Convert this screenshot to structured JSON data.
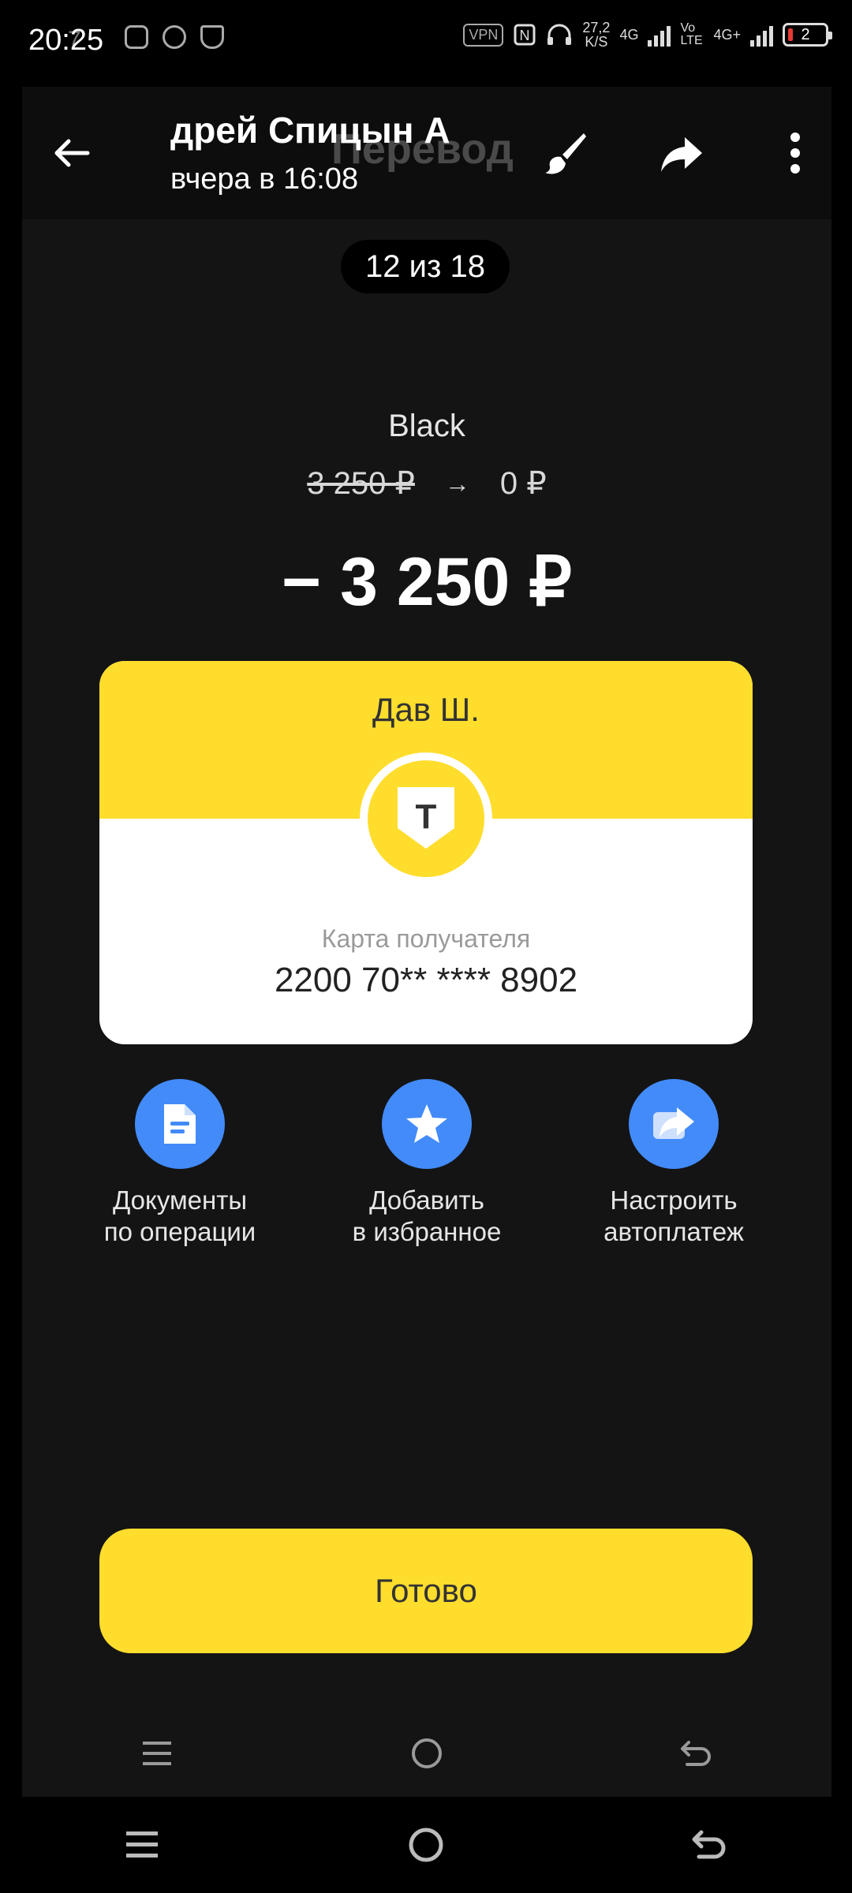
{
  "status_bar": {
    "time": "20:25",
    "ghost_time": "7",
    "vpn": "VPN",
    "speed_value": "27,2",
    "speed_unit": "K/S",
    "network1": "4G",
    "network2": "Vo LTE",
    "network3": "4G+",
    "battery": "2"
  },
  "header": {
    "title": "дрей Спицын  А",
    "ghost_title": "Перевод",
    "subtitle": "вчера в 16:08"
  },
  "counter": "12 из 18",
  "transfer": {
    "product": "Black",
    "balance_before": "3 250 ₽",
    "balance_arrow": "→",
    "balance_after": "0 ₽",
    "amount": "− 3 250 ₽"
  },
  "card": {
    "recipient_name": "Дав Ш.",
    "logo_letter": "Т",
    "label": "Карта получателя",
    "number": "2200 70** **** 8902"
  },
  "actions": [
    {
      "label": "Документы\nпо операции",
      "icon": "document-icon"
    },
    {
      "label": "Добавить\nв избранное",
      "icon": "star-icon"
    },
    {
      "label": "Настроить\nавтоплатеж",
      "icon": "autopay-icon"
    }
  ],
  "done_label": "Готово",
  "colors": {
    "accent_yellow": "#ffdd2d",
    "action_blue": "#428bf9",
    "background": "#141414"
  }
}
